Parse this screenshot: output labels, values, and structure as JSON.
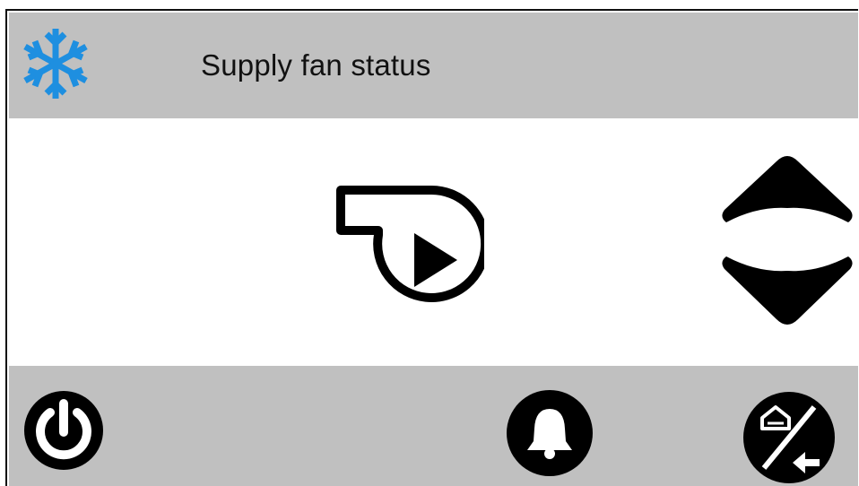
{
  "header": {
    "icon": "snowflake-icon",
    "title": "Supply fan status",
    "accent_color": "#1e8fe0",
    "background": "#c0c0c0"
  },
  "content": {
    "fan_icon": "fan-running-icon",
    "up_button_icon": "arrow-up-icon",
    "down_button_icon": "arrow-down-icon"
  },
  "footer": {
    "background": "#c0c0c0",
    "buttons": [
      {
        "icon": "power-icon"
      },
      {
        "icon": "alarm-bell-icon"
      },
      {
        "icon": "home-back-icon"
      }
    ]
  }
}
